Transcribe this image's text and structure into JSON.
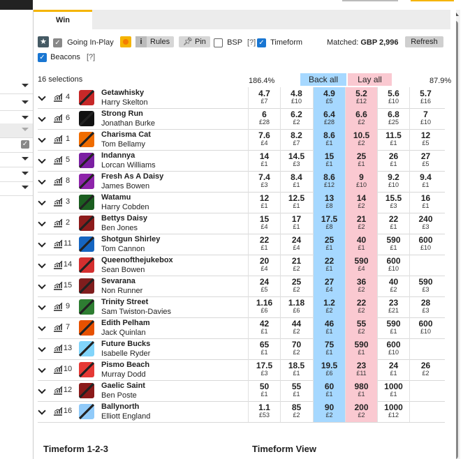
{
  "tabs": {
    "active": "Win"
  },
  "toolbar": {
    "inplay_label": "Going In-Play",
    "rules_label": "Rules",
    "pin_label": "Pin",
    "bsp_label": "BSP",
    "timeform_label": "Timeform",
    "help": "[?]",
    "matched_label": "Matched:",
    "matched_value": "GBP 2,996",
    "refresh_label": "Refresh",
    "beacons_label": "Beacons"
  },
  "market": {
    "selections": "16 selections",
    "back_overround": "186.4%",
    "lay_overround": "87.9%",
    "back_all": "Back all",
    "lay_all": "Lay all"
  },
  "runners": [
    {
      "num": "4",
      "name": "Getawhisky",
      "jockey": "Harry Skelton",
      "silk": "#c62828",
      "prices": [
        [
          "4.7",
          "£7"
        ],
        [
          "4.8",
          "£10"
        ],
        [
          "4.9",
          "£5"
        ],
        [
          "5.2",
          "£12"
        ],
        [
          "5.6",
          "£10"
        ],
        [
          "5.7",
          "£16"
        ]
      ]
    },
    {
      "num": "6",
      "name": "Strong Run",
      "jockey": "Jonathan Burke",
      "silk": "#111111",
      "prices": [
        [
          "6",
          "£28"
        ],
        [
          "6.2",
          "£2"
        ],
        [
          "6.4",
          "£28"
        ],
        [
          "6.6",
          "£2"
        ],
        [
          "6.8",
          "£25"
        ],
        [
          "7",
          "£10"
        ]
      ]
    },
    {
      "num": "1",
      "name": "Charisma Cat",
      "jockey": "Tom Bellamy",
      "silk": "#ef6c00",
      "prices": [
        [
          "7.6",
          "£4"
        ],
        [
          "8.2",
          "£7"
        ],
        [
          "8.6",
          "£1"
        ],
        [
          "10.5",
          "£2"
        ],
        [
          "11.5",
          "£1"
        ],
        [
          "12",
          "£5"
        ]
      ]
    },
    {
      "num": "5",
      "name": "Indannya",
      "jockey": "Lorcan Williams",
      "silk": "#7b1fa2",
      "prices": [
        [
          "14",
          "£1"
        ],
        [
          "14.5",
          "£3"
        ],
        [
          "15",
          "£1"
        ],
        [
          "25",
          "£1"
        ],
        [
          "26",
          "£1"
        ],
        [
          "27",
          "£5"
        ]
      ]
    },
    {
      "num": "8",
      "name": "Fresh As A Daisy",
      "jockey": "James Bowen",
      "silk": "#8e24aa",
      "prices": [
        [
          "7.4",
          "£3"
        ],
        [
          "8.4",
          "£1"
        ],
        [
          "8.6",
          "£12"
        ],
        [
          "9",
          "£10"
        ],
        [
          "9.2",
          "£10"
        ],
        [
          "9.4",
          "£1"
        ]
      ]
    },
    {
      "num": "3",
      "name": "Watamu",
      "jockey": "Harry Cobden",
      "silk": "#1b5e20",
      "prices": [
        [
          "12",
          "£1"
        ],
        [
          "12.5",
          "£1"
        ],
        [
          "13",
          "£8"
        ],
        [
          "14",
          "£2"
        ],
        [
          "15.5",
          "£3"
        ],
        [
          "16",
          "£1"
        ]
      ]
    },
    {
      "num": "2",
      "name": "Bettys Daisy",
      "jockey": "Ben Jones",
      "silk": "#8d1b1b",
      "prices": [
        [
          "15",
          "£4"
        ],
        [
          "17",
          "£1"
        ],
        [
          "17.5",
          "£8"
        ],
        [
          "21",
          "£2"
        ],
        [
          "22",
          "£1"
        ],
        [
          "240",
          "£3"
        ]
      ]
    },
    {
      "num": "11",
      "name": "Shotgun Shirley",
      "jockey": "Tom Cannon",
      "silk": "#1565c0",
      "prices": [
        [
          "22",
          "£1"
        ],
        [
          "24",
          "£4"
        ],
        [
          "25",
          "£1"
        ],
        [
          "40",
          "£1"
        ],
        [
          "590",
          "£1"
        ],
        [
          "600",
          "£10"
        ]
      ]
    },
    {
      "num": "14",
      "name": "Queenofthejukebox",
      "jockey": "Sean Bowen",
      "silk": "#d32f2f",
      "prices": [
        [
          "20",
          "£4"
        ],
        [
          "21",
          "£2"
        ],
        [
          "22",
          "£1"
        ],
        [
          "590",
          "£4"
        ],
        [
          "600",
          "£10"
        ],
        [
          "",
          ""
        ]
      ]
    },
    {
      "num": "15",
      "name": "Sevarana",
      "jockey": "Non Runner",
      "silk": "#7f1d1d",
      "prices": [
        [
          "24",
          "£5"
        ],
        [
          "25",
          "£2"
        ],
        [
          "27",
          "£4"
        ],
        [
          "36",
          "£2"
        ],
        [
          "40",
          "£2"
        ],
        [
          "590",
          "£3"
        ]
      ]
    },
    {
      "num": "9",
      "name": "Trinity Street",
      "jockey": "Sam Twiston-Davies",
      "silk": "#2e7d32",
      "prices": [
        [
          "1.16",
          "£6"
        ],
        [
          "1.18",
          "£6"
        ],
        [
          "1.2",
          "£2"
        ],
        [
          "22",
          "£2"
        ],
        [
          "23",
          "£21"
        ],
        [
          "28",
          "£3"
        ]
      ]
    },
    {
      "num": "7",
      "name": "Edith Pelham",
      "jockey": "Jack Quinlan",
      "silk": "#e65100",
      "prices": [
        [
          "42",
          "£1"
        ],
        [
          "44",
          "£2"
        ],
        [
          "46",
          "£1"
        ],
        [
          "55",
          "£2"
        ],
        [
          "590",
          "£1"
        ],
        [
          "600",
          "£10"
        ]
      ]
    },
    {
      "num": "13",
      "name": "Future Bucks",
      "jockey": "Isabelle Ryder",
      "silk": "#81d4fa",
      "prices": [
        [
          "65",
          "£1"
        ],
        [
          "70",
          "£2"
        ],
        [
          "75",
          "£1"
        ],
        [
          "590",
          "£1"
        ],
        [
          "600",
          "£10"
        ],
        [
          "",
          ""
        ]
      ]
    },
    {
      "num": "10",
      "name": "Pismo Beach",
      "jockey": "Murray Dodd",
      "silk": "#e53935",
      "prices": [
        [
          "17.5",
          "£3"
        ],
        [
          "18.5",
          "£1"
        ],
        [
          "19.5",
          "£6"
        ],
        [
          "23",
          "£11"
        ],
        [
          "24",
          "£1"
        ],
        [
          "26",
          "£2"
        ]
      ]
    },
    {
      "num": "12",
      "name": "Gaelic Saint",
      "jockey": "Ben Poste",
      "silk": "#8b1a1a",
      "prices": [
        [
          "50",
          "£1"
        ],
        [
          "55",
          "£1"
        ],
        [
          "60",
          "£1"
        ],
        [
          "980",
          "£1"
        ],
        [
          "1000",
          "£1"
        ],
        [
          "",
          ""
        ]
      ]
    },
    {
      "num": "16",
      "name": "Ballynorth",
      "jockey": "Elliott England",
      "silk": "#90caf9",
      "prices": [
        [
          "1.1",
          "£53"
        ],
        [
          "85",
          "£2"
        ],
        [
          "90",
          "£2"
        ],
        [
          "200",
          "£2"
        ],
        [
          "1000",
          "£12"
        ],
        [
          "",
          ""
        ]
      ]
    }
  ],
  "footer": {
    "left": "Timeform 1-2-3",
    "right": "Timeform View"
  }
}
